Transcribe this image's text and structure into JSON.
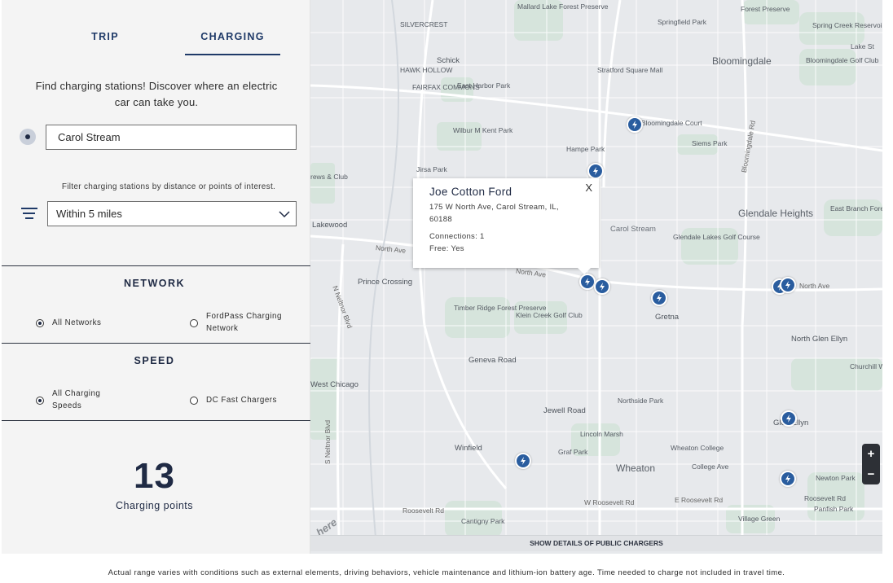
{
  "tabs": [
    {
      "label": "TRIP"
    },
    {
      "label": "CHARGING"
    }
  ],
  "intro_text": "Find charging stations! Discover where an electric car can take you.",
  "location": {
    "value": "Carol Stream",
    "icon": "location-dot-icon"
  },
  "filter": {
    "hint": "Filter charging stations by distance or points of interest.",
    "selected": "Within 5 miles",
    "icon": "filter-icon"
  },
  "network": {
    "title": "NETWORK",
    "options": [
      {
        "label": "All Networks",
        "selected": true
      },
      {
        "label": "FordPass Charging Network",
        "selected": false
      }
    ]
  },
  "speed": {
    "title": "SPEED",
    "options": [
      {
        "label": "All Charging Speeds",
        "selected": true
      },
      {
        "label": "DC Fast Chargers",
        "selected": false
      }
    ]
  },
  "summary": {
    "count": "13",
    "label": "Charging points"
  },
  "map": {
    "popup": {
      "name": "Joe Cotton Ford",
      "address": "175 W North Ave, Carol Stream, IL, 60188",
      "connections": "Connections: 1",
      "free": "Free: Yes",
      "close": "X"
    },
    "zoom_in": "+",
    "zoom_out": "−",
    "logo": "here",
    "details_button": "SHOW DETAILS OF PUBLIC CHARGERS",
    "places": [
      {
        "text": "Mallard Lake Forest Preserve"
      },
      {
        "text": "Springfield Park"
      },
      {
        "text": "Forest Preserve"
      },
      {
        "text": "Spring Creek Reservoir"
      },
      {
        "text": "Lake St"
      },
      {
        "text": "SILVERCREST"
      },
      {
        "text": "Schick"
      },
      {
        "text": "Stratford Square Mall"
      },
      {
        "text": "Bloomingdale"
      },
      {
        "text": "Bloomingdale Golf Club"
      },
      {
        "text": "HAWK HOLLOW"
      },
      {
        "text": "FAIRFAX COMMONS"
      },
      {
        "text": "East Harbor Park"
      },
      {
        "text": "Wilbur M Kent Park"
      },
      {
        "text": "Bloomingdale Court"
      },
      {
        "text": "Siems Park"
      },
      {
        "text": "Hampe Park"
      },
      {
        "text": "Jirsa Park"
      },
      {
        "text": "Glendale Heights"
      },
      {
        "text": "East Branch Forest Preserve"
      },
      {
        "text": "Lakewood"
      },
      {
        "text": "Carol Stream"
      },
      {
        "text": "Glendale Lakes Golf Course"
      },
      {
        "text": "Prince Crossing"
      },
      {
        "text": "Timber Ridge Forest Preserve"
      },
      {
        "text": "Klein Creek Golf Club"
      },
      {
        "text": "Gretna"
      },
      {
        "text": "North Glen Ellyn"
      },
      {
        "text": "Churchill Woods Forest Preserve"
      },
      {
        "text": "Geneva Road"
      },
      {
        "text": "West Chicago"
      },
      {
        "text": "Jewell Road"
      },
      {
        "text": "Northside Park"
      },
      {
        "text": "Lincoln Marsh"
      },
      {
        "text": "Glen Ellyn"
      },
      {
        "text": "Winfield"
      },
      {
        "text": "Graf Park"
      },
      {
        "text": "Wheaton College"
      },
      {
        "text": "College Ave"
      },
      {
        "text": "Wheaton"
      },
      {
        "text": "Newton Park"
      },
      {
        "text": "Roosevelt Rd"
      },
      {
        "text": "Panfish Park"
      },
      {
        "text": "Cantigny Park"
      },
      {
        "text": "Village Green"
      },
      {
        "text": "W Roosevelt Rd"
      },
      {
        "text": "E Roosevelt Rd"
      },
      {
        "text": "North Ave"
      },
      {
        "text": "N Neltnor Blvd"
      },
      {
        "text": "S Neltnor Blvd"
      },
      {
        "text": "Bloomingdale Rd"
      },
      {
        "text": "rews & Club"
      }
    ]
  },
  "disclaimer": "Actual range varies with conditions such as external elements, driving behaviors, vehicle maintenance and lithium-ion battery age. Time needed to charge not included in travel time."
}
